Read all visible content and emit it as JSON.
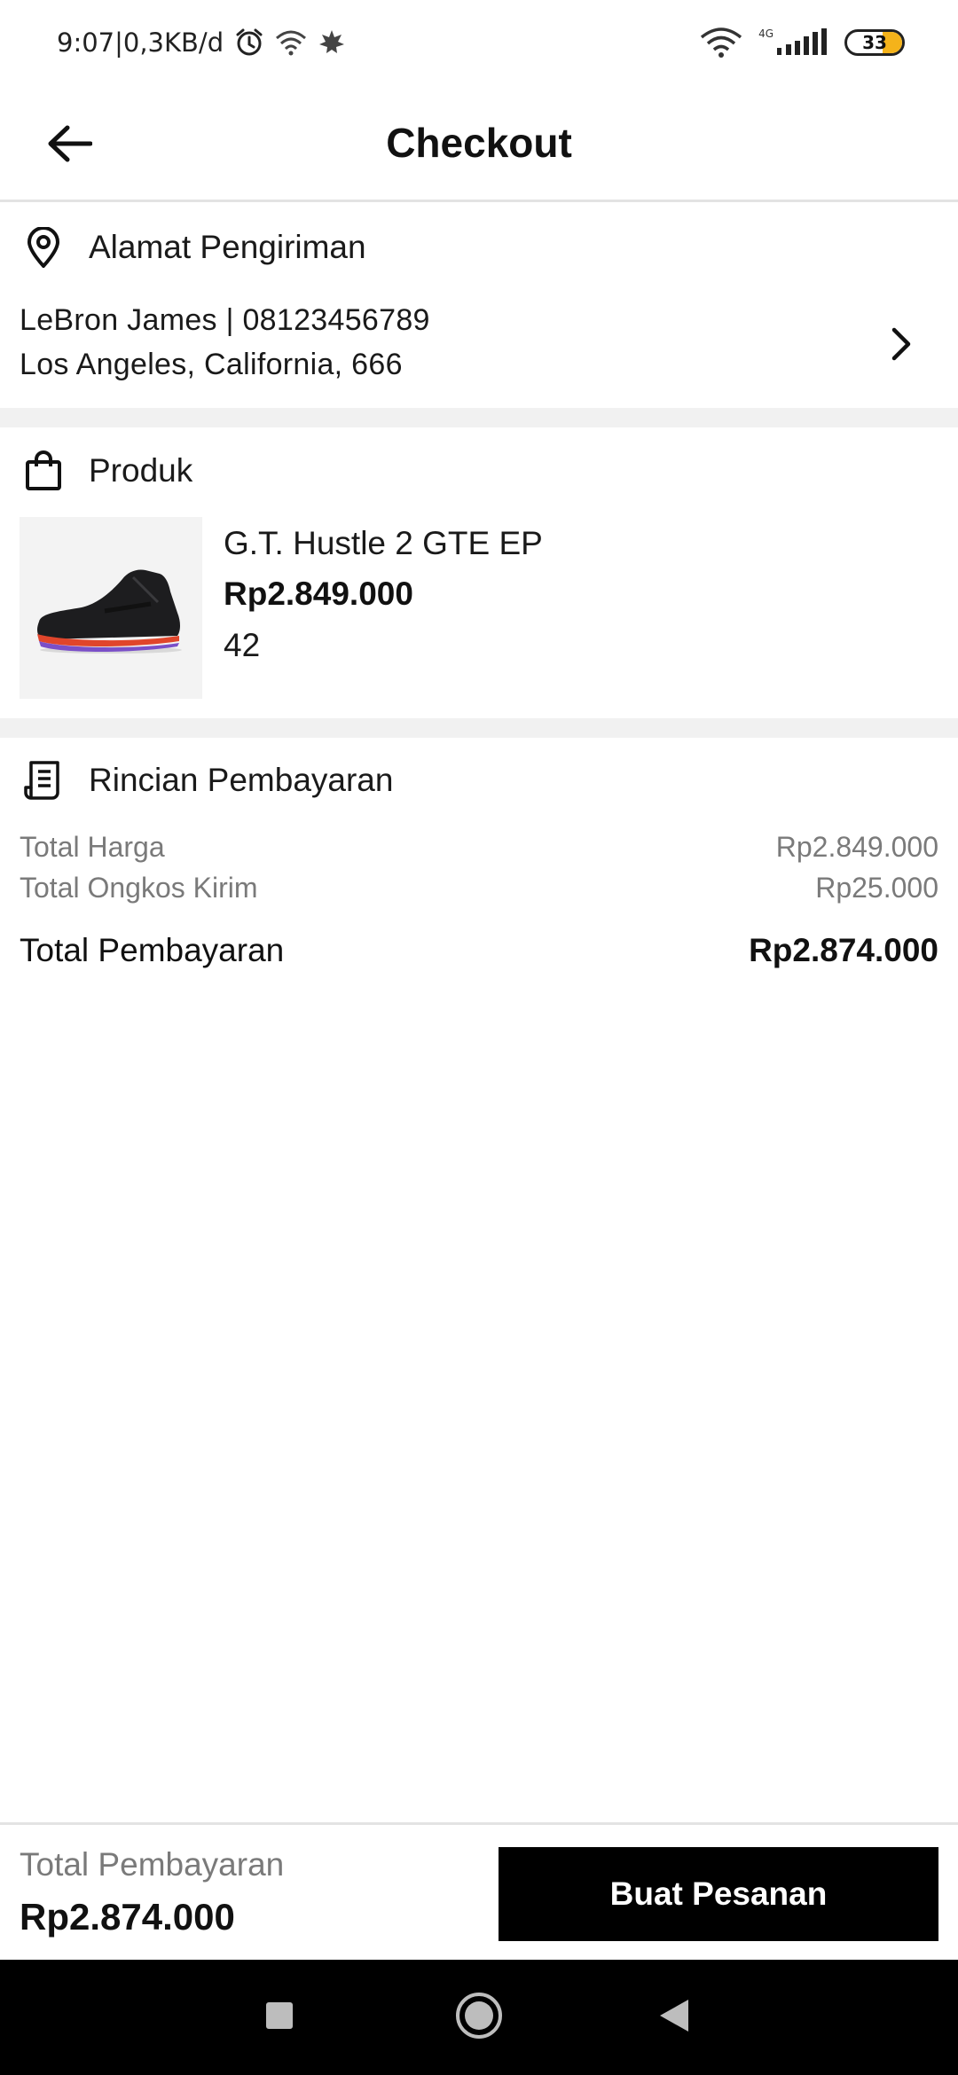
{
  "status_bar": {
    "time_speed": "9:07|0,3KB/d",
    "network_type": "4G",
    "battery_level": "33",
    "icons": [
      "alarm-icon",
      "wifi-icon",
      "leaf-icon",
      "wifi-icon",
      "signal-icon",
      "battery-icon"
    ]
  },
  "appbar": {
    "title": "Checkout",
    "back_icon": "arrow-left-icon"
  },
  "address": {
    "heading": "Alamat Pengiriman",
    "icon": "location-pin-icon",
    "name_phone": "LeBron James | 08123456789",
    "location": "Los Angeles, California, 666",
    "chevron_icon": "chevron-right-icon"
  },
  "product": {
    "heading": "Produk",
    "icon": "shopping-bag-icon",
    "name": "G.T. Hustle 2 GTE EP",
    "price": "Rp2.849.000",
    "size": "42",
    "image_icon": "shoe-image"
  },
  "payment": {
    "heading": "Rincian Pembayaran",
    "icon": "receipt-icon",
    "rows": [
      {
        "label": "Total Harga",
        "value": "Rp2.849.000"
      },
      {
        "label": "Total Ongkos Kirim",
        "value": "Rp25.000"
      }
    ],
    "total_label": "Total Pembayaran",
    "total_value": "Rp2.874.000"
  },
  "bottom_bar": {
    "label": "Total Pembayaran",
    "total": "Rp2.874.000",
    "button_label": "Buat Pesanan"
  },
  "nav": {
    "buttons": [
      "recents-square-icon",
      "home-circle-icon",
      "back-triangle-icon"
    ]
  },
  "colors": {
    "accent": "#000000",
    "divider": "#f1f1f1",
    "muted_text": "#7a7a7a",
    "battery_fill": "#f5b31a"
  }
}
